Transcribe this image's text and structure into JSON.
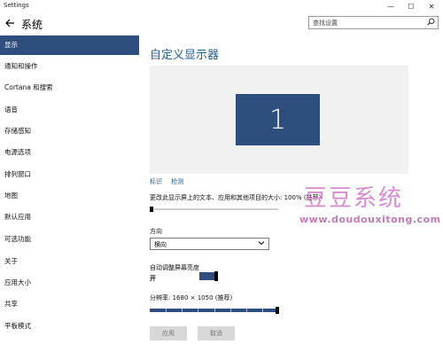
{
  "window": {
    "title": "Settings",
    "controls": {
      "minimize": "—",
      "maximize": "☐",
      "close": "✕"
    }
  },
  "header": {
    "back_icon": "back-arrow-icon",
    "settings_icon": "gear-icon",
    "title": "系统",
    "search_placeholder": "查找设置"
  },
  "sidebar": {
    "active_index": 0,
    "items": [
      {
        "label": "显示"
      },
      {
        "label": "通知和操作"
      },
      {
        "label": "Cortana 和搜索"
      },
      {
        "label": "语音"
      },
      {
        "label": "存储感知"
      },
      {
        "label": "电源选项"
      },
      {
        "label": "排列窗口"
      },
      {
        "label": "地图"
      },
      {
        "label": "默认应用"
      },
      {
        "label": "可选功能"
      },
      {
        "label": "关于"
      },
      {
        "label": "应用大小"
      },
      {
        "label": "共享"
      },
      {
        "label": "平板模式"
      }
    ]
  },
  "main": {
    "section_title": "自定义显示器",
    "monitor_number": "1",
    "links": {
      "identify": "标识",
      "detect": "检测"
    },
    "scale": {
      "label": "更改此显示屏上的文本、应用和其他项目的大小: 100% (推荐)",
      "value_fraction": 0.0
    },
    "orientation": {
      "label": "方向",
      "selected": "横向"
    },
    "auto_brightness": {
      "label": "自动调整屏幕亮度",
      "state": "开",
      "on": true
    },
    "resolution": {
      "label": "分辨率: 1680 × 1050 (推荐)",
      "value_fraction": 1.0,
      "tick_count": 8
    },
    "buttons": {
      "apply": "应用",
      "cancel": "取消"
    }
  },
  "watermark": {
    "text": "豆豆系统",
    "url": "www.doudouxitong.com"
  },
  "colors": {
    "accent": "#2e4e7e",
    "link": "#1f5d95",
    "watermark": "#d98bd2"
  }
}
